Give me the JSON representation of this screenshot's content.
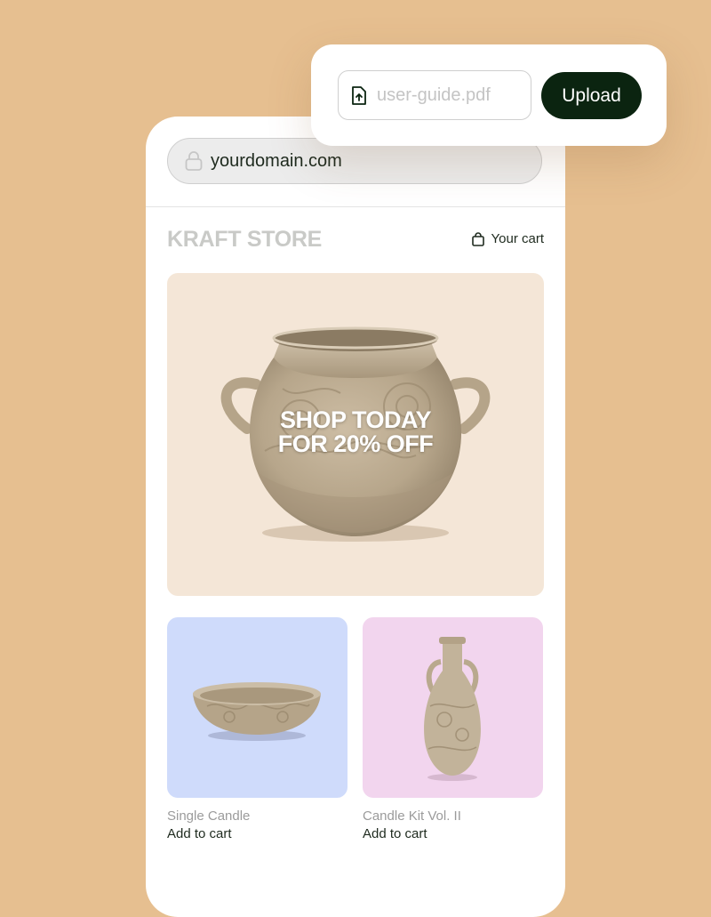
{
  "browser": {
    "url": "yourdomain.com"
  },
  "store": {
    "title": "KRAFT STORE",
    "cart_label": "Your cart"
  },
  "hero": {
    "line1": "SHOP TODAY",
    "line2": "FOR 20% OFF",
    "background_color": "#f4e6d7"
  },
  "products": [
    {
      "name": "Single Candle",
      "action": "Add to cart",
      "background_color": "#cfdbfb"
    },
    {
      "name": "Candle Kit Vol. II",
      "action": "Add to cart",
      "background_color": "#f2d5ee"
    }
  ],
  "uploader": {
    "file_name": "user-guide.pdf",
    "button_label": "Upload",
    "button_color": "#0b2410"
  },
  "icons": [
    "lock-icon",
    "shopping-bag-icon",
    "file-upload-icon"
  ]
}
